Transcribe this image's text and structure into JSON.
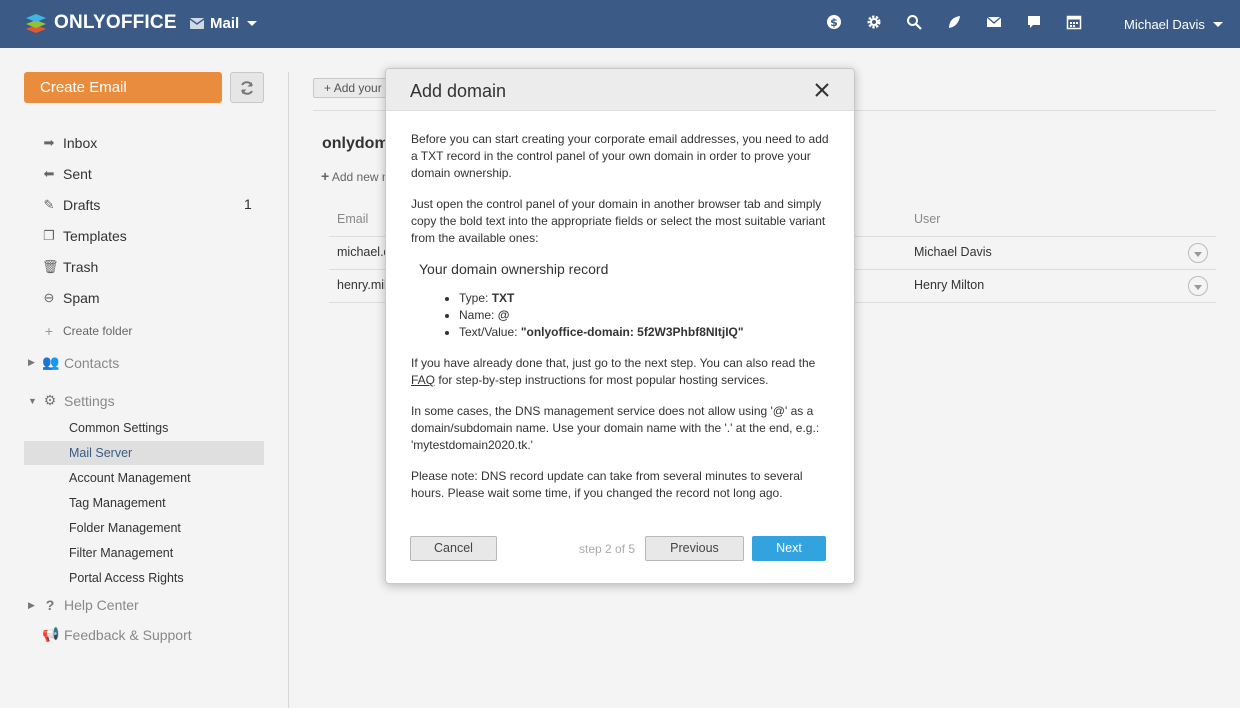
{
  "header": {
    "logo_text": "ONLYOFFICE",
    "module_label": "Mail",
    "user_name": "Michael Davis",
    "icons": [
      "payments-icon",
      "settings-icon",
      "search-icon",
      "feed-icon",
      "mail-icon",
      "chat-icon",
      "calendar-icon"
    ]
  },
  "sidebar": {
    "create_label": "Create Email",
    "folders": [
      {
        "label": "Inbox",
        "icon": "inbox-icon"
      },
      {
        "label": "Sent",
        "icon": "sent-icon"
      },
      {
        "label": "Drafts",
        "icon": "drafts-icon",
        "count": "1"
      },
      {
        "label": "Templates",
        "icon": "templates-icon"
      },
      {
        "label": "Trash",
        "icon": "trash-icon"
      },
      {
        "label": "Spam",
        "icon": "spam-icon"
      }
    ],
    "create_folder": "Create folder",
    "contacts": "Contacts",
    "settings": "Settings",
    "settings_items": [
      "Common Settings",
      "Mail Server",
      "Account Management",
      "Tag Management",
      "Folder Management",
      "Filter Management",
      "Portal Access Rights"
    ],
    "active_setting": "Mail Server",
    "help": "Help Center",
    "feedback": "Feedback & Support"
  },
  "main": {
    "add_button": "Add your own domain",
    "domain": "onlydomain",
    "add_mailbox": "Add new mailbox",
    "columns": {
      "email": "Email",
      "user": "User"
    },
    "rows": [
      {
        "email": "michael.davis",
        "user": "Michael Davis"
      },
      {
        "email": "henry.milton",
        "user": "Henry Milton"
      }
    ]
  },
  "dialog": {
    "title": "Add domain",
    "p1": "Before you can start creating your corporate email addresses, you need to add a TXT record in the control panel of your own domain in order to prove your domain ownership.",
    "p2": "Just open the control panel of your domain in another browser tab and simply copy the bold text into the appropriate fields or select the most suitable variant from the available ones:",
    "record_title": "Your domain ownership record",
    "record": {
      "type_label": "Type:",
      "type_value": "TXT",
      "name_label": "Name:",
      "name_value": "@",
      "text_label": "Text/Value:",
      "text_value": "\"onlyoffice-domain: 5f2W3Phbf8NItjIQ\""
    },
    "p3_before": "If you have already done that, just go to the next step. You can also read the",
    "p3_link": "FAQ",
    "p3_after": "for step-by-step instructions for most popular hosting services.",
    "p4": "In some cases, the DNS management service does not allow using '@' as a domain/subdomain name. Use your domain name with the '.' at the end, e.g.: 'mytestdomain2020.tk.'",
    "p5": "Please note: DNS record update can take from several minutes to several hours. Please wait some time, if you changed the record not long ago.",
    "cancel": "Cancel",
    "step": "step 2 of 5",
    "previous": "Previous",
    "next": "Next"
  },
  "colors": {
    "topbar": "#3b5b86",
    "create": "#e98c3d",
    "next": "#33a3e0",
    "active_bg": "#dfdfdf"
  }
}
